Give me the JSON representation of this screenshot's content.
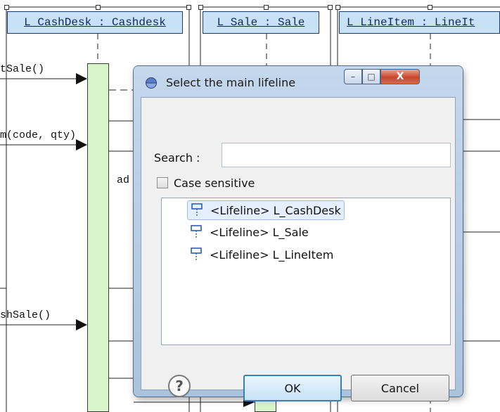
{
  "diagram": {
    "lifelines": [
      {
        "id": "cashdesk",
        "label": "L_CashDesk : Cashdesk"
      },
      {
        "id": "sale",
        "label": "L_Sale : Sale"
      },
      {
        "id": "lineitem",
        "label": "L_LineItem : LineIt"
      }
    ],
    "messages": [
      {
        "id": "startsale",
        "label": "tSale()"
      },
      {
        "id": "enteritem",
        "label": "m(code, qty)"
      },
      {
        "id": "add",
        "label": "ad"
      },
      {
        "id": "finishsale",
        "label": "shSale()"
      }
    ]
  },
  "dialog": {
    "title": "Select the main lifeline",
    "controls": {
      "minimize": "–",
      "maximize": "□",
      "close": "X"
    },
    "search_label": "Search :",
    "search_value": "",
    "case_sensitive_label": "Case sensitive",
    "case_sensitive_checked": false,
    "lifelines": [
      {
        "label": "<Lifeline> L_CashDesk",
        "selected": true
      },
      {
        "label": "<Lifeline> L_Sale",
        "selected": false
      },
      {
        "label": "<Lifeline> L_LineItem",
        "selected": false
      }
    ],
    "help_glyph": "?",
    "ok_label": "OK",
    "cancel_label": "Cancel"
  }
}
